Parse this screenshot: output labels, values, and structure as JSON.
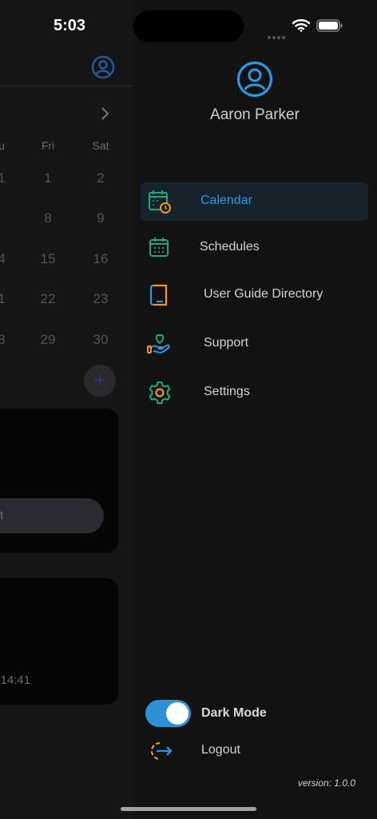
{
  "status_bar": {
    "time": "5:03"
  },
  "background": {
    "weekdays": [
      "u",
      "Fri",
      "Sat"
    ],
    "rows": [
      [
        "1",
        "1",
        "2"
      ],
      [
        "",
        "8",
        "9"
      ],
      [
        "4",
        "15",
        "16"
      ],
      [
        "1",
        "22",
        "23"
      ],
      [
        "8",
        "29",
        "30"
      ]
    ],
    "fab_label": "+",
    "pill_text": "t",
    "timestamp": "4 14:41"
  },
  "drawer": {
    "user_name": "Aaron Parker",
    "menu": [
      {
        "label": "Calendar",
        "icon": "calendar-clock-icon",
        "active": true
      },
      {
        "label": "Schedules",
        "icon": "calendar-grid-icon",
        "active": false
      },
      {
        "label": "User Guide Directory",
        "icon": "book-icon",
        "active": false
      },
      {
        "label": "Support",
        "icon": "hand-heart-icon",
        "active": false
      },
      {
        "label": "Settings",
        "icon": "gear-icon",
        "active": false
      }
    ],
    "dark_mode_label": "Dark Mode",
    "dark_mode_on": true,
    "logout_label": "Logout",
    "version": "version: 1.0.0"
  },
  "colors": {
    "accent_blue": "#2f97e0",
    "accent_green": "#1fa97a",
    "accent_orange": "#f2962b",
    "drawer_bg": "#121212",
    "active_item_bg": "#16222c"
  }
}
